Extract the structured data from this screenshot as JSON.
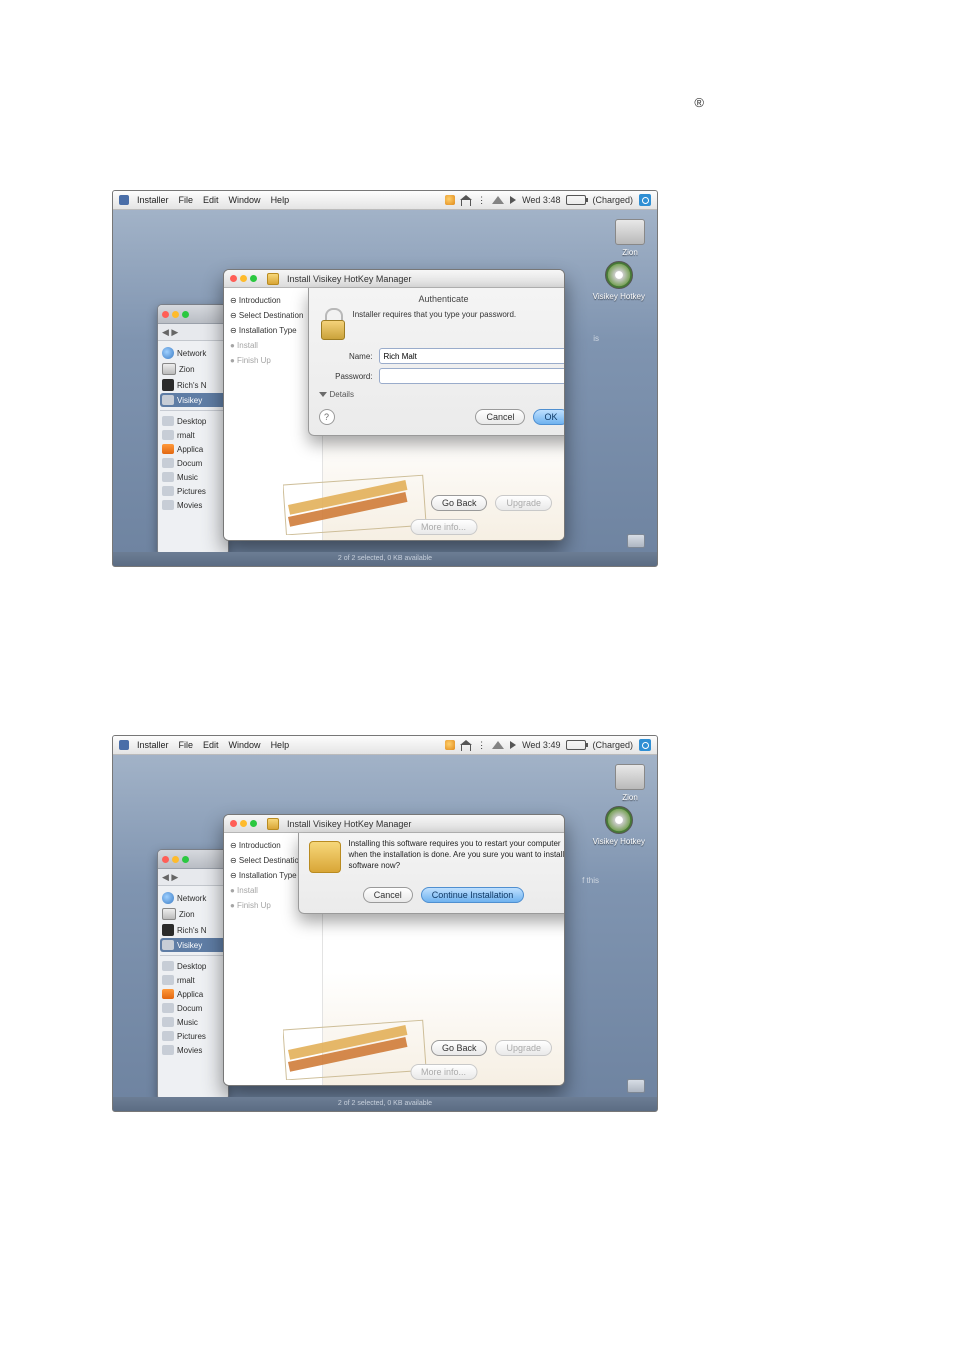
{
  "registered_mark": "®",
  "menubar": {
    "items": [
      "Installer",
      "File",
      "Edit",
      "Window",
      "Help"
    ],
    "time1": "Wed 3:48",
    "time2": "Wed 3:49",
    "battery": "(Charged)"
  },
  "desktop": {
    "hd_label": "Zion",
    "cd_label": "Visikey Hotkey"
  },
  "finder": {
    "toolbar_nav": "◀  ▶",
    "items": [
      {
        "label": "Network",
        "icon": "net"
      },
      {
        "label": "Zion",
        "icon": "hd"
      },
      {
        "label": "Rich's N",
        "icon": "ipod"
      },
      {
        "label": "Visikey",
        "icon": "cd",
        "selected": true
      },
      {
        "label": "Desktop",
        "icon": "folder"
      },
      {
        "label": "rmalt",
        "icon": "home"
      },
      {
        "label": "Applica",
        "icon": "app"
      },
      {
        "label": "Docum",
        "icon": "folder"
      },
      {
        "label": "Music",
        "icon": "music"
      },
      {
        "label": "Pictures",
        "icon": "folder"
      },
      {
        "label": "Movies",
        "icon": "folder"
      }
    ]
  },
  "installer": {
    "title": "Install Visikey HotKey Manager",
    "steps": {
      "intro": "⊖ Introduction",
      "dest": "⊖ Select Destination",
      "type": "⊖ Installation Type",
      "install": "● Install",
      "finish": "● Finish Up"
    },
    "go_back": "Go Back",
    "upgrade": "Upgrade",
    "more_info": "More info...",
    "rail_text": "f this",
    "rail_text1": "is"
  },
  "auth": {
    "sheet_title": "Authenticate",
    "message": "Installer requires that you type your password.",
    "name_label": "Name:",
    "name_value": "Rich Malt",
    "password_label": "Password:",
    "password_value": "",
    "details": "Details",
    "cancel": "Cancel",
    "ok": "OK",
    "help": "?"
  },
  "restart": {
    "message": "Installing this software requires you to restart your computer when the installation is done. Are you sure you want to install the software now?",
    "cancel": "Cancel",
    "continue": "Continue Installation"
  },
  "footer": "2 of 2 selected, 0 KB available"
}
